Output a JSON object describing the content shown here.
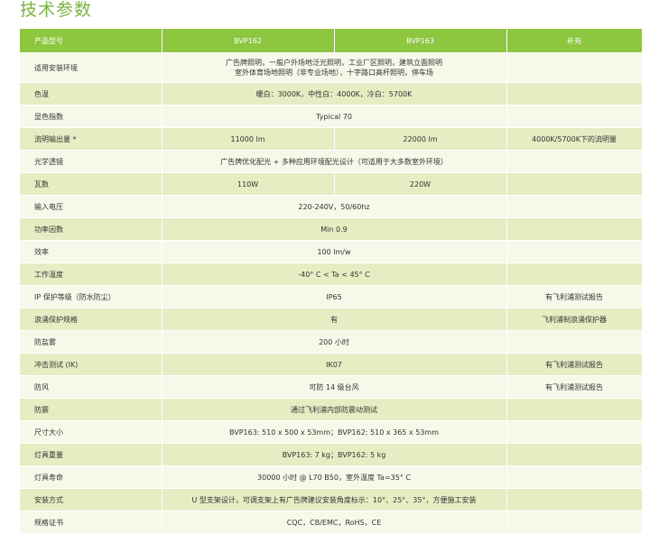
{
  "title": "技术参数",
  "headers": [
    "产品型号",
    "BVP162",
    "BVP163",
    "补充"
  ],
  "rows": [
    {
      "label": "适用安装环境",
      "span": "广告牌照明，一般户外场地泛光照明，工业厂区照明，建筑立面照明\n室外体育场地照明（非专业场地），十字路口高杆照明，停车场",
      "note": ""
    },
    {
      "label": "色温",
      "span": "暖白：3000K，中性白：4000K，冷白：5700K",
      "note": ""
    },
    {
      "label": "显色指数",
      "span": "Typical 70",
      "note": ""
    },
    {
      "label": "流明输出量 *",
      "c2": "11000 lm",
      "c3": "22000 lm",
      "note": "4000K/5700K下的流明量"
    },
    {
      "label": "光学透镜",
      "span": "广告牌优化配光 + 多种应用环境配光设计（可适用于大多数室外环境）",
      "note": ""
    },
    {
      "label": "瓦数",
      "c2": "110W",
      "c3": "220W",
      "note": ""
    },
    {
      "label": "输入电压",
      "span": "220-240V，50/60hz",
      "note": ""
    },
    {
      "label": "功率因数",
      "span": "Min 0.9",
      "note": ""
    },
    {
      "label": "效率",
      "span": "100 lm/w",
      "note": ""
    },
    {
      "label": "工作温度",
      "span": "-40° C < Ta < 45° C",
      "note": ""
    },
    {
      "label": "IP 保护等级（防水防尘）",
      "span": "IP65",
      "note": "有飞利浦测试报告"
    },
    {
      "label": "浪涌保护规格",
      "span": "有",
      "note": "飞利浦制浪涌保护器"
    },
    {
      "label": "防盐雾",
      "span": "200 小时",
      "note": ""
    },
    {
      "label": "冲击测试 (IK)",
      "span": "IK07",
      "note": "有飞利浦测试报告"
    },
    {
      "label": "防风",
      "span": "可防 14 级台风",
      "note": "有飞利浦测试报告"
    },
    {
      "label": "防震",
      "span": "通过飞利浦内部防震动测试",
      "note": ""
    },
    {
      "label": "尺寸大小",
      "span": "BVP163: 510 x 500 x 53mm；BVP162: 510 x 365 x 53mm",
      "note": ""
    },
    {
      "label": "灯具重量",
      "span": "BVP163: 7 kg；BVP162: 5 kg",
      "note": ""
    },
    {
      "label": "灯具寿命",
      "span": "30000 小时 @ L70 B50，室外温度 Ta=35° C",
      "note": ""
    },
    {
      "label": "安装方式",
      "span": "U 型支架设计，可调支架上有广告牌建议安装角度标示：10°、25°、35°，方便施工安装",
      "note": ""
    },
    {
      "label": "规格证书",
      "span": "CQC，CB/EMC，RoHS，CE",
      "note": ""
    }
  ]
}
